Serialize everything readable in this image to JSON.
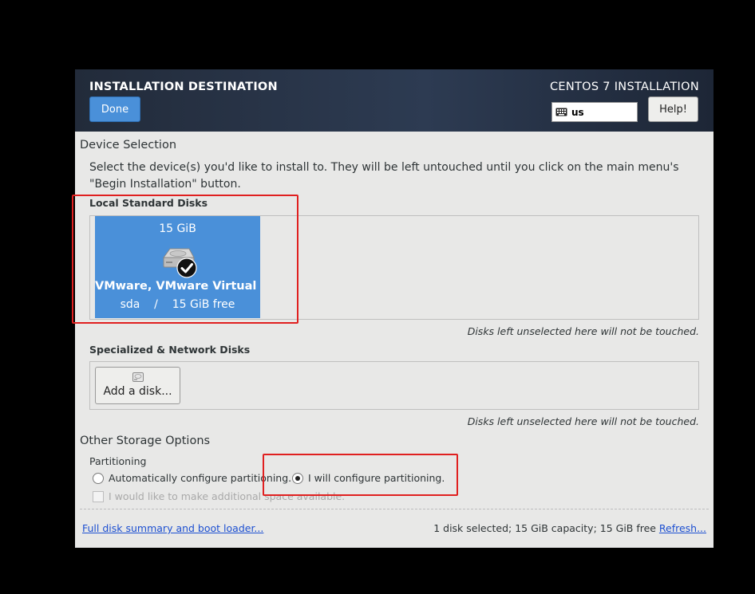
{
  "header": {
    "title": "INSTALLATION DESTINATION",
    "product": "CENTOS 7 INSTALLATION",
    "done_label": "Done",
    "keyboard_layout": "us",
    "help_label": "Help!"
  },
  "device_selection": {
    "title": "Device Selection",
    "description": "Select the device(s) you'd like to install to.  They will be left untouched until you click on the main menu's \"Begin Installation\" button."
  },
  "local_disks": {
    "title": "Local Standard Disks",
    "disk": {
      "size": "15 GiB",
      "name": "VMware, VMware Virtual S",
      "info": "sda    /    15 GiB free",
      "selected": true
    },
    "note": "Disks left unselected here will not be touched."
  },
  "network_disks": {
    "title": "Specialized & Network Disks",
    "add_label": "Add a disk...",
    "note": "Disks left unselected here will not be touched."
  },
  "other_storage": {
    "title": "Other Storage Options",
    "partitioning_title": "Partitioning",
    "auto_option": "Automatically configure partitioning.",
    "manual_option": "I will configure partitioning.",
    "selected_option": "manual",
    "extra_space_option": "I would like to make additional space available."
  },
  "footer": {
    "summary_link": "Full disk summary and boot loader...",
    "summary_text": "1 disk selected; 15 GiB capacity; 15 GiB free",
    "refresh_link": "Refresh..."
  },
  "colors": {
    "header_bg": "#222b3a",
    "accent": "#4a90d9",
    "highlight_box": "#e02020",
    "link": "#1c4fd1"
  }
}
